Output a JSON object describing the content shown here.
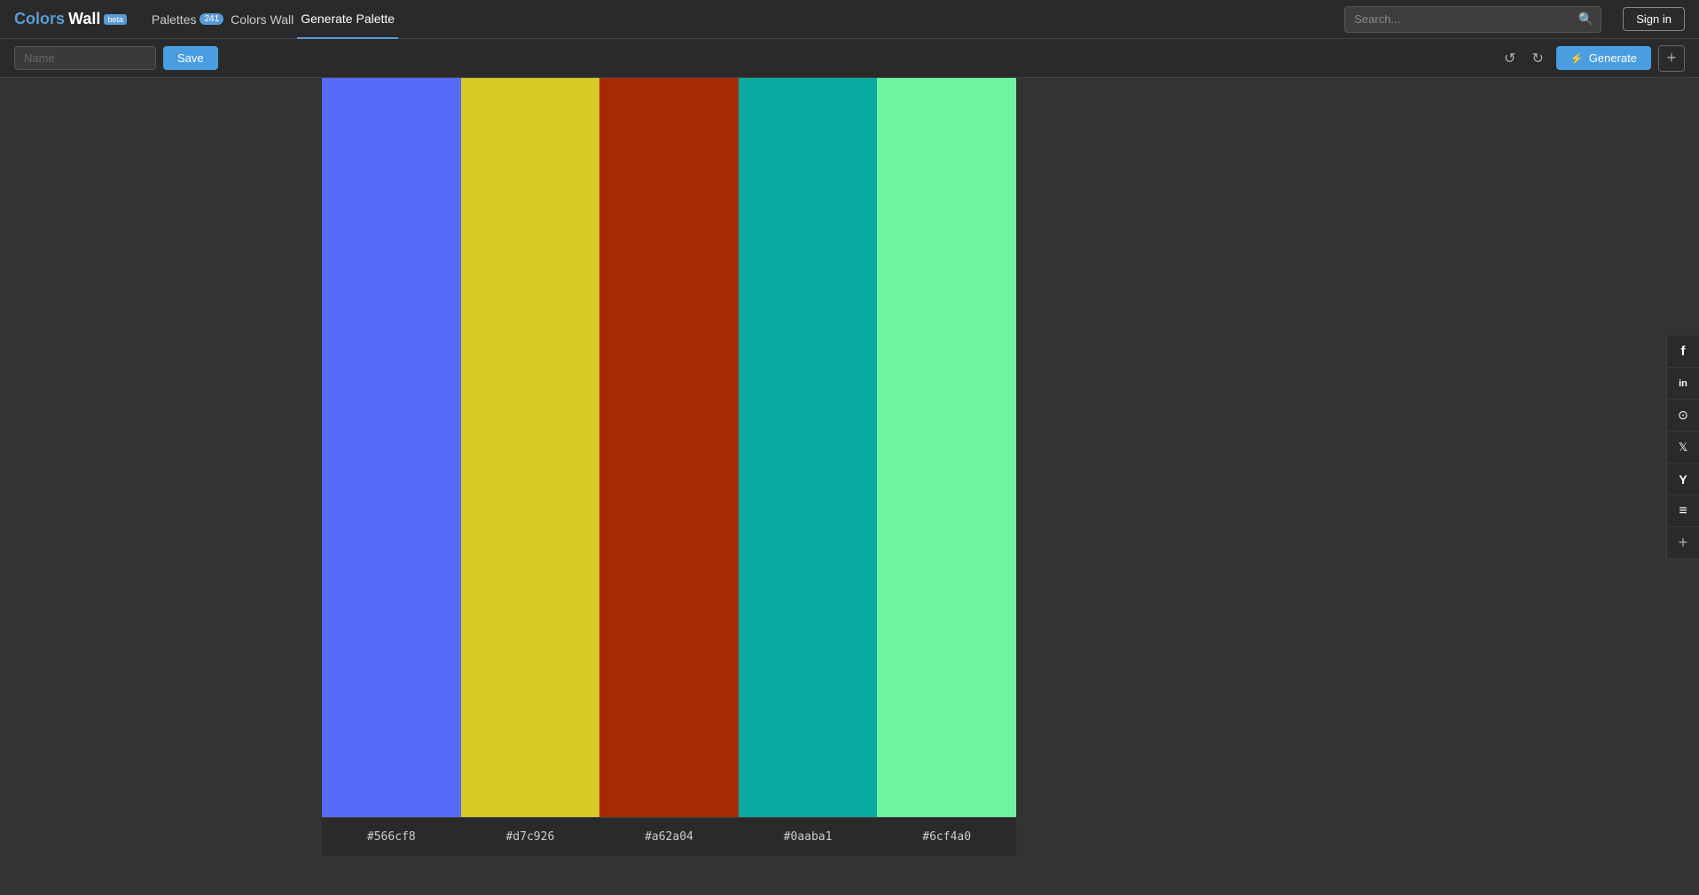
{
  "header": {
    "logo": {
      "brand": "Colors",
      "name_part": "Wall",
      "beta": "beta"
    },
    "nav": [
      {
        "id": "palettes",
        "label": "Palettes",
        "badge": "241",
        "active": false
      },
      {
        "id": "colors-wall",
        "label": "Colors Wall",
        "active": false
      },
      {
        "id": "generate-palette",
        "label": "Generate Palette",
        "active": true
      }
    ],
    "search": {
      "placeholder": "Search...",
      "value": ""
    },
    "signin": "Sign in"
  },
  "toolbar": {
    "name_placeholder": "Name",
    "save_label": "Save",
    "undo_icon": "↺",
    "redo_icon": "↻",
    "generate_label": "Generate",
    "add_icon": "+"
  },
  "palette": {
    "colors": [
      {
        "hex": "#566cf8",
        "label": "#566cf8"
      },
      {
        "hex": "#d7c926",
        "label": "#d7c926"
      },
      {
        "hex": "#a62a04",
        "label": "#a62a04"
      },
      {
        "hex": "#0aaba1",
        "label": "#0aaba1"
      },
      {
        "hex": "#6cf4a0",
        "label": "#6cf4a0"
      }
    ]
  },
  "social": [
    {
      "id": "facebook",
      "icon": "f",
      "label": "Facebook"
    },
    {
      "id": "linkedin",
      "icon": "in",
      "label": "LinkedIn"
    },
    {
      "id": "pocket",
      "icon": "⊙",
      "label": "Pocket"
    },
    {
      "id": "twitter",
      "icon": "𝕏",
      "label": "Twitter"
    },
    {
      "id": "hacker-news",
      "icon": "Y",
      "label": "Hacker News"
    },
    {
      "id": "buffer",
      "icon": "≡",
      "label": "Buffer"
    },
    {
      "id": "more",
      "icon": "+",
      "label": "More"
    }
  ]
}
